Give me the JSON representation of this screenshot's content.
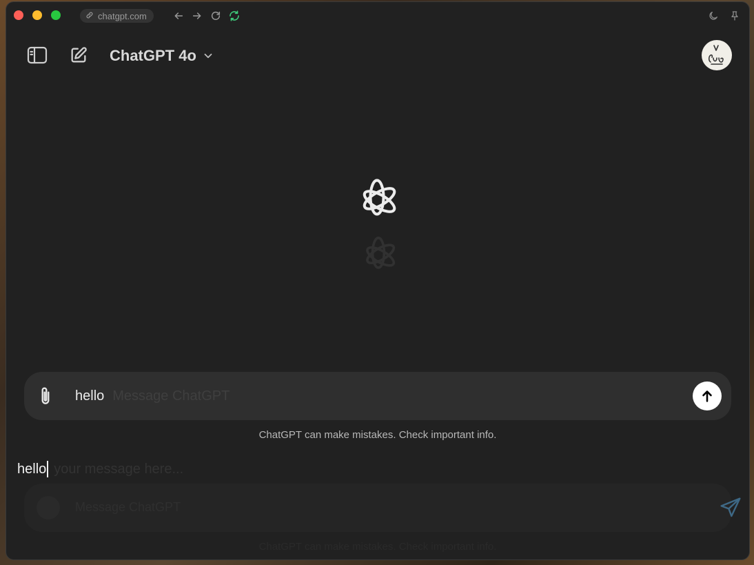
{
  "browser": {
    "url": "chatgpt.com",
    "icons": [
      "link-icon",
      "back-arrow-icon",
      "forward-arrow-icon",
      "reload-icon",
      "sync-icon",
      "moon-icon",
      "pin-icon"
    ]
  },
  "header": {
    "model_name": "ChatGPT 4o",
    "icons": [
      "sidebar-toggle-icon",
      "new-chat-icon",
      "chevron-down-icon"
    ]
  },
  "composer": {
    "value": "hello",
    "placeholder": "Message ChatGPT"
  },
  "disclaimer": "ChatGPT can make mistakes. Check important info.",
  "overlay": {
    "typed_value": "hello",
    "placeholder": "your message here...",
    "input_placeholder": "Message ChatGPT",
    "disclaimer": "ChatGPT can make mistakes. Check important info."
  },
  "colors": {
    "window_bg": "#212121",
    "composer_bg": "#2f2f2f",
    "send_button_bg": "#ffffff",
    "sync_icon": "#3ec97a"
  }
}
